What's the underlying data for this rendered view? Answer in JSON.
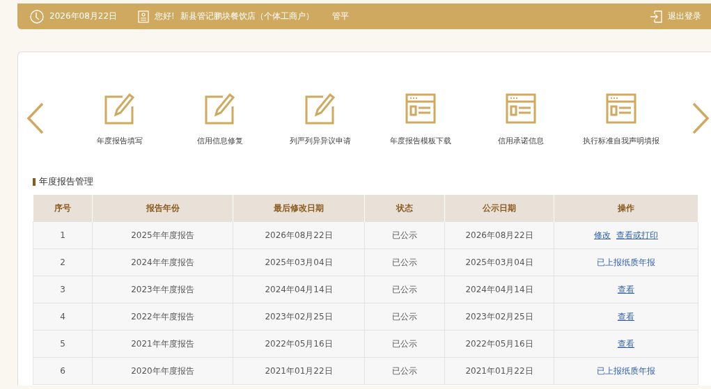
{
  "header": {
    "date": "2026年08月22日",
    "greeting": "您好!",
    "company": "新县管记鹏块餐饮店（个体工商户）",
    "user": "管平",
    "logout": "退出登录"
  },
  "shortcuts": [
    {
      "label": "年度报告填写",
      "kind": "edit"
    },
    {
      "label": "信用信息修复",
      "kind": "edit"
    },
    {
      "label": "列严列异异议申请",
      "kind": "edit"
    },
    {
      "label": "年度报告模板下载",
      "kind": "form"
    },
    {
      "label": "信用承诺信息",
      "kind": "form"
    },
    {
      "label": "执行标准自我声明填报",
      "kind": "form"
    }
  ],
  "section_title": "年度报告管理",
  "table": {
    "columns": [
      "序号",
      "报告年份",
      "最后修改日期",
      "状态",
      "公示日期",
      "操作"
    ],
    "rows": [
      {
        "cells": [
          "1",
          "2025年年度报告",
          "2026年08月22日",
          "已公示",
          "2026年08月22日"
        ],
        "actions": [
          {
            "text": "修改",
            "kind": "link"
          },
          {
            "text": "查看或打印",
            "kind": "link"
          }
        ]
      },
      {
        "cells": [
          "2",
          "2024年年度报告",
          "2025年03月04日",
          "已公示",
          "2025年03月04日"
        ],
        "actions": [
          {
            "text": "已上报纸质年报",
            "kind": "text"
          }
        ]
      },
      {
        "cells": [
          "3",
          "2023年年度报告",
          "2024年04月14日",
          "已公示",
          "2024年04月14日"
        ],
        "actions": [
          {
            "text": "查看",
            "kind": "link"
          }
        ]
      },
      {
        "cells": [
          "4",
          "2022年年度报告",
          "2023年02月25日",
          "已公示",
          "2023年02月25日"
        ],
        "actions": [
          {
            "text": "查看",
            "kind": "link"
          }
        ]
      },
      {
        "cells": [
          "5",
          "2021年年度报告",
          "2022年05月16日",
          "已公示",
          "2022年05月16日"
        ],
        "actions": [
          {
            "text": "查看",
            "kind": "link"
          }
        ]
      },
      {
        "cells": [
          "6",
          "2020年年度报告",
          "2021年01月22日",
          "已公示",
          "2021年01月22日"
        ],
        "actions": [
          {
            "text": "已上报纸质年报",
            "kind": "text"
          }
        ]
      }
    ]
  }
}
